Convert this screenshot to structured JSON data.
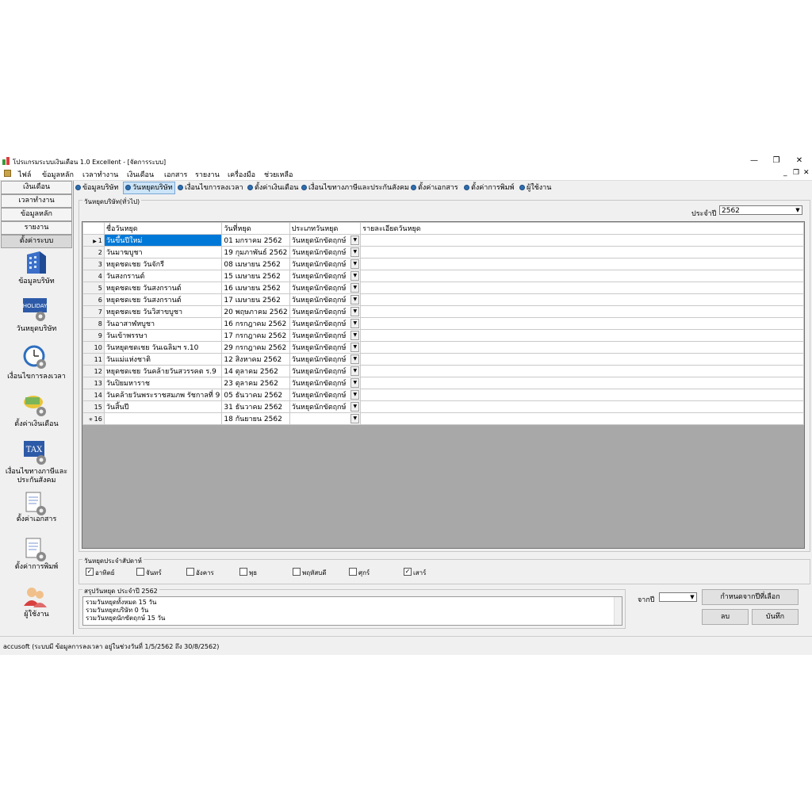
{
  "window": {
    "title": "โปรแกรมระบบเงินเดือน 1.0 Excellent - [จัดการระบบ]",
    "minimize": "—",
    "restore": "❐",
    "close": "✕"
  },
  "menu": {
    "items": [
      "ไฟล์",
      "ข้อมูลหลัก",
      "เวลาทำงาน",
      "เงินเดือน",
      "เอกสาร",
      "รายงาน",
      "เครื่องมือ",
      "ช่วยเหลือ"
    ],
    "mdi_controls": [
      "_",
      "❐",
      "✕"
    ]
  },
  "sidebar": {
    "buttons": [
      "เงินเดือน",
      "เวลาทำงาน",
      "ข้อมูลหลัก",
      "รายงาน",
      "ตั้งค่าระบบ"
    ],
    "items": [
      {
        "label": "ข้อมูลบริษัท",
        "icon": "building-icon"
      },
      {
        "label": "วันหยุดบริษัท",
        "icon": "holiday-icon",
        "icon_text": "HOLIDAY"
      },
      {
        "label": "เงื่อนไขการลงเวลา",
        "icon": "clock-gear-icon"
      },
      {
        "label": "ตั้งค่าเงินเดือน",
        "icon": "money-gear-icon"
      },
      {
        "label": "เงื่อนไขทางภาษีและ",
        "label2": "ประกันสังคม",
        "icon": "tax-icon",
        "icon_text": "TAX"
      },
      {
        "label": "ตั้งค่าเอกสาร",
        "icon": "document-gear-icon"
      },
      {
        "label": "ตั้งค่าการพิมพ์",
        "icon": "print-settings-icon"
      },
      {
        "label": "ผู้ใช้งาน",
        "icon": "users-icon"
      }
    ]
  },
  "tabs": [
    "ข้อมูลบริษัท",
    "วันหยุดบริษัท",
    "เงื่อนไขการลงเวลา",
    "ตั้งค่าเงินเดือน",
    "เงื่อนไขทางภาษีและประกันสังคม",
    "ตั้งค่าเอกสาร",
    "ตั้งค่าการพิมพ์",
    "ผู้ใช้งาน"
  ],
  "holiday_group": {
    "title": "วันหยุดบริษัท(ทั่วไป)",
    "year_label": "ประจำปี",
    "year_value": "2562",
    "columns": [
      "ชื่อวันหยุด",
      "วันที่หยุด",
      "ประเภทวันหยุด",
      "รายละเอียดวันหยุด"
    ],
    "rows": [
      {
        "no": "1",
        "name": "วันขึ้นปีใหม่",
        "date": "01 มกราคม 2562",
        "type": "วันหยุดนักขัตฤกษ์",
        "detail": ""
      },
      {
        "no": "2",
        "name": "วันมาฆบูชา",
        "date": "19 กุมภาพันธ์ 2562",
        "type": "วันหยุดนักขัตฤกษ์",
        "detail": ""
      },
      {
        "no": "3",
        "name": "หยุดชดเชย วันจักรี",
        "date": "08 เมษายน 2562",
        "type": "วันหยุดนักขัตฤกษ์",
        "detail": ""
      },
      {
        "no": "4",
        "name": "วันสงกรานต์",
        "date": "15 เมษายน 2562",
        "type": "วันหยุดนักขัตฤกษ์",
        "detail": ""
      },
      {
        "no": "5",
        "name": "หยุดชดเชย วันสงกรานต์",
        "date": "16 เมษายน 2562",
        "type": "วันหยุดนักขัตฤกษ์",
        "detail": ""
      },
      {
        "no": "6",
        "name": "หยุดชดเชย วันสงกรานต์",
        "date": "17 เมษายน 2562",
        "type": "วันหยุดนักขัตฤกษ์",
        "detail": ""
      },
      {
        "no": "7",
        "name": "หยุดชดเชย วันวิสาขบูชา",
        "date": "20 พฤษภาคม 2562",
        "type": "วันหยุดนักขัตฤกษ์",
        "detail": ""
      },
      {
        "no": "8",
        "name": "วันอาสาฬหบูชา",
        "date": "16 กรกฎาคม 2562",
        "type": "วันหยุดนักขัตฤกษ์",
        "detail": ""
      },
      {
        "no": "9",
        "name": "วันเข้าพรรษา",
        "date": "17 กรกฎาคม 2562",
        "type": "วันหยุดนักขัตฤกษ์",
        "detail": ""
      },
      {
        "no": "10",
        "name": "วันหยุดชดเชย วันเฉลิมฯ ร.10",
        "date": "29 กรกฎาคม 2562",
        "type": "วันหยุดนักขัตฤกษ์",
        "detail": ""
      },
      {
        "no": "11",
        "name": "วันแม่แห่งชาติ",
        "date": "12 สิงหาคม 2562",
        "type": "วันหยุดนักขัตฤกษ์",
        "detail": ""
      },
      {
        "no": "12",
        "name": "หยุดชดเชย วันคล้ายวันสวรรคต ร.9",
        "date": "14 ตุลาคม 2562",
        "type": "วันหยุดนักขัตฤกษ์",
        "detail": ""
      },
      {
        "no": "13",
        "name": "วันปิยมหาราช",
        "date": "23 ตุลาคม 2562",
        "type": "วันหยุดนักขัตฤกษ์",
        "detail": ""
      },
      {
        "no": "14",
        "name": "วันคล้ายวันพระราชสมภพ รัชกาลที่ 9",
        "date": "05 ธันวาคม 2562",
        "type": "วันหยุดนักขัตฤกษ์",
        "detail": ""
      },
      {
        "no": "15",
        "name": "วันสิ้นปี",
        "date": "31 ธันวาคม 2562",
        "type": "วันหยุดนักขัตฤกษ์",
        "detail": ""
      }
    ],
    "new_row": {
      "no": "16",
      "name": "",
      "date": "18 กันยายน 2562",
      "type": "",
      "detail": ""
    }
  },
  "weekly_group": {
    "title": "วันหยุดประจำสัปดาห์",
    "days": [
      {
        "label": "อาทิตย์",
        "checked": true
      },
      {
        "label": "จันทร์",
        "checked": false
      },
      {
        "label": "อังคาร",
        "checked": false
      },
      {
        "label": "พุธ",
        "checked": false
      },
      {
        "label": "พฤหัสบดี",
        "checked": false
      },
      {
        "label": "ศุกร์",
        "checked": false
      },
      {
        "label": "เสาร์",
        "checked": true
      }
    ]
  },
  "summary_group": {
    "title": "สรุปวันหยุด ประจำปี 2562",
    "lines": [
      "รวมวันหยุดทั้งหมด 15 วัน",
      "รวมวันหยุดบริษัท 0 วัน",
      "รวมวันหยุดนักขัตฤกษ์ 15 วัน"
    ]
  },
  "actions": {
    "from_year_label": "จากปี",
    "from_year_value": "",
    "copy_button": "กำหนดจากปีที่เลือก",
    "delete_button": "ลบ",
    "save_button": "บันทึก"
  },
  "status_bar": "accusoft (ระบบมี ข้อมูลการลงเวลา อยู่ในช่วงวันที่ 1/5/2562 ถึง 30/8/2562)",
  "colors": {
    "selection": "#0078d7",
    "grid_empty": "#a8a8a8",
    "tab_active": "#cce4f7"
  }
}
